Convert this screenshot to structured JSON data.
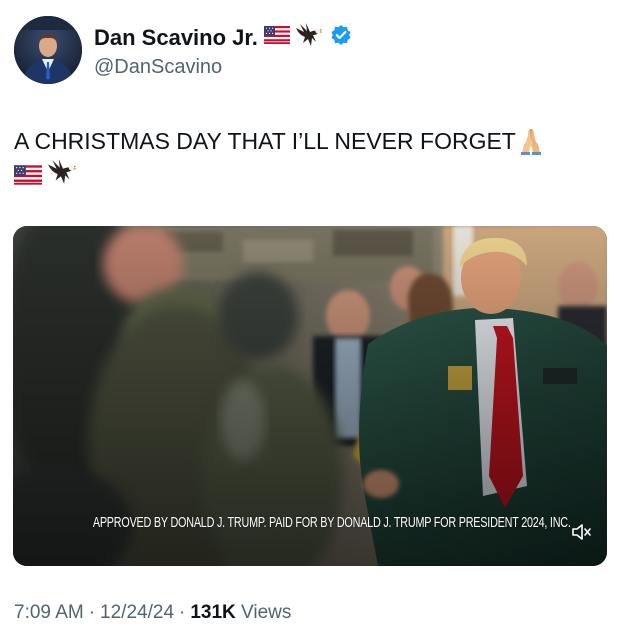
{
  "author": {
    "display_name": "Dan Scavino Jr.",
    "handle": "@DanScavino",
    "name_icons": [
      "us-flag-icon",
      "eagle-icon",
      "verified-badge-icon"
    ],
    "verified_color": "#1d9bf0"
  },
  "tweet": {
    "text": "A CHRISTMAS DAY THAT I’LL NEVER FORGET",
    "text_emojis": [
      "praying-hands-icon",
      "us-flag-icon",
      "eagle-icon"
    ]
  },
  "video": {
    "disclaimer": "APPROVED BY DONALD J. TRUMP. PAID FOR BY DONALD J. TRUMP FOR PRESIDENT 2024, INC.",
    "controls": [
      "speaker-muted-icon"
    ]
  },
  "meta": {
    "time": "7:09 AM",
    "separator": "·",
    "date": "12/24/24",
    "views_count": "131K",
    "views_label": "Views"
  },
  "colors": {
    "text_primary": "#0f1419",
    "text_secondary": "#536471",
    "verified": "#1d9bf0"
  }
}
